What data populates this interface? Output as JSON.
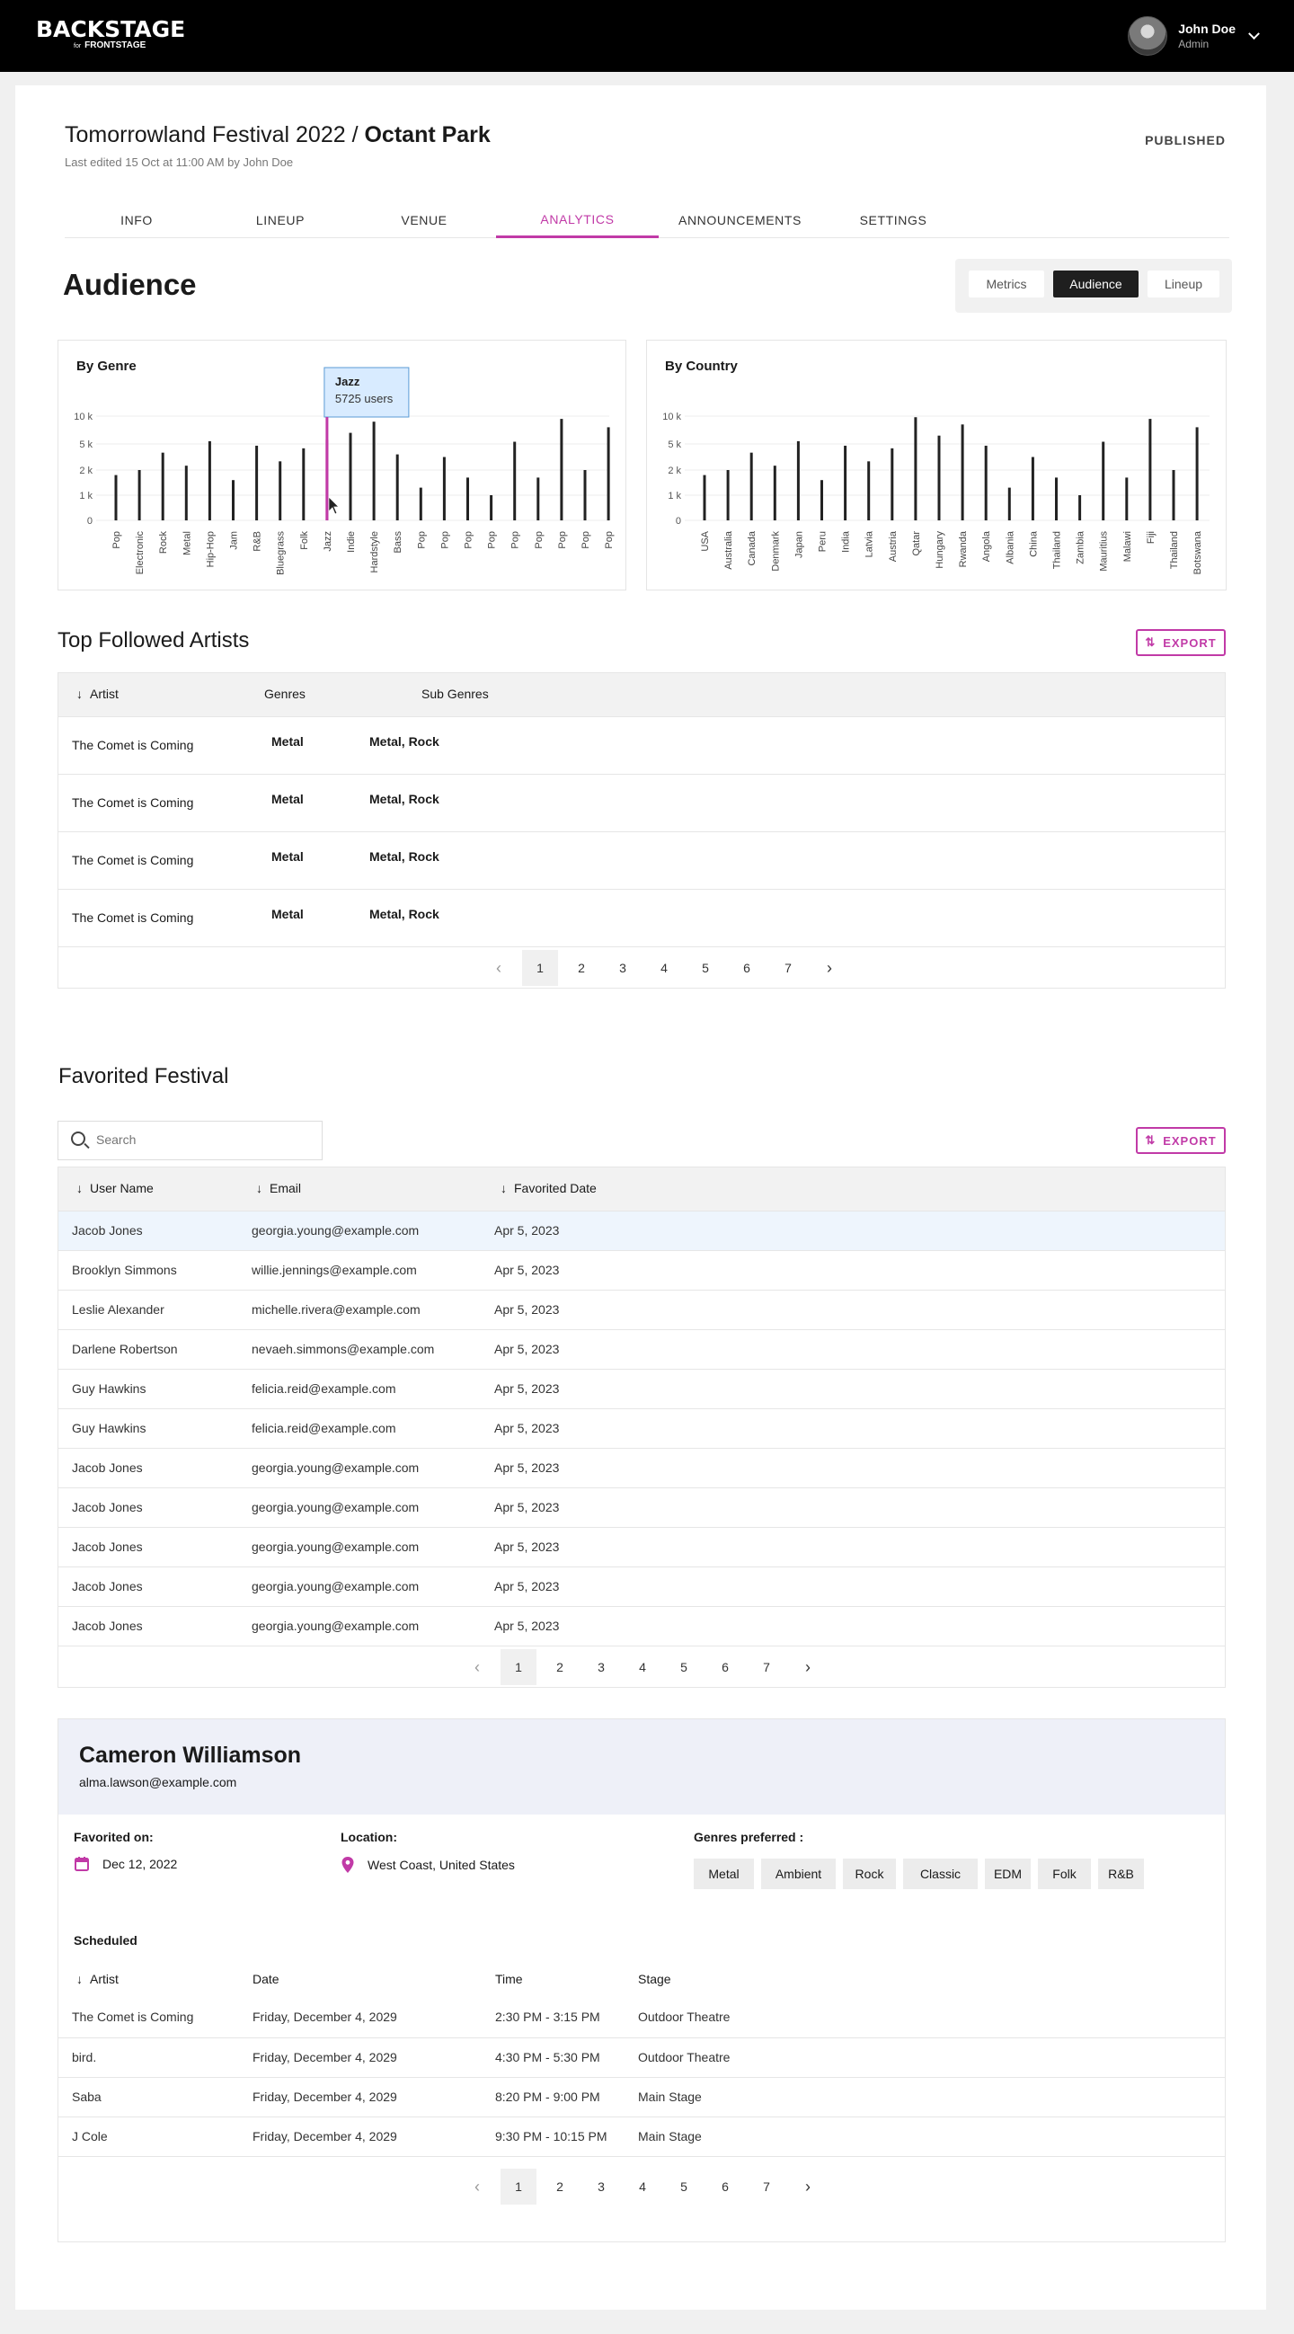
{
  "header": {
    "logo_main": "BACKSTAGE",
    "logo_for": "for",
    "logo_sub": "FRONTSTAGE",
    "user_name": "John Doe",
    "user_role": "Admin"
  },
  "event": {
    "title_part1": "Tomorrowland Festival 2022 / ",
    "title_part2": "Octant Park",
    "subtitle": "Last edited 15 Oct at 11:00 AM by John Doe",
    "status": "PUBLISHED"
  },
  "tabs": [
    "INFO",
    "LINEUP",
    "VENUE",
    "ANALYTICS",
    "ANNOUNCEMENTS",
    "SETTINGS"
  ],
  "active_tab": "ANALYTICS",
  "audience": {
    "heading": "Audience",
    "segments": [
      "Metrics",
      "Audience",
      "Lineup"
    ],
    "active_segment": "Audience"
  },
  "colors": {
    "accent": "#c13aa7",
    "tooltip_bg": "#d8ebff",
    "tooltip_border": "#5b9bd5"
  },
  "chart_data": [
    {
      "type": "bar",
      "title": "By Genre",
      "yticks": [
        "0",
        "1 k",
        "2 k",
        "5 k",
        "10 k"
      ],
      "categories": [
        "Pop",
        "Electronic",
        "Rock",
        "Metal",
        "Hip-Hop",
        "Jam",
        "R&B",
        "Bluegrass",
        "Folk",
        "Jazz",
        "Indie",
        "Hardstyle",
        "Bass",
        "Pop",
        "Pop",
        "Pop",
        "Pop",
        "Pop",
        "Pop",
        "Pop",
        "Pop",
        "Pop"
      ],
      "values": [
        1800,
        2000,
        4000,
        2500,
        5500,
        1600,
        4800,
        3000,
        4500,
        5725,
        7000,
        9000,
        3800,
        1300,
        3500,
        1700,
        1000,
        5400,
        1700,
        9500,
        2000,
        8000
      ],
      "tooltip": {
        "label": "Jazz",
        "value_text": "5725 users"
      },
      "highlight": "Jazz"
    },
    {
      "type": "bar",
      "title": "By Country",
      "yticks": [
        "0",
        "1 k",
        "2 k",
        "5 k",
        "10 k"
      ],
      "categories": [
        "USA",
        "Australia",
        "Canada",
        "Denmark",
        "Japan",
        "Peru",
        "India",
        "Latvia",
        "Austria",
        "Qatar",
        "Hungary",
        "Rwanda",
        "Angola",
        "Albania",
        "China",
        "Thailand",
        "Zambia",
        "Mauritius",
        "Malawi",
        "Fiji",
        "Thailand",
        "Botswana"
      ],
      "values": [
        1800,
        2000,
        4000,
        2500,
        5500,
        1600,
        4800,
        3000,
        4500,
        9800,
        6500,
        8500,
        4800,
        1300,
        3500,
        1700,
        1000,
        5400,
        1700,
        9500,
        2000,
        8000
      ]
    }
  ],
  "top_artists": {
    "heading": "Top Followed Artists",
    "export_label": "EXPORT",
    "columns": [
      "Artist",
      "Genres",
      "Sub Genres"
    ],
    "rows": [
      {
        "artist": "The  Comet is Coming",
        "genre": "Metal",
        "sub": "Metal, Rock"
      },
      {
        "artist": "The  Comet is Coming",
        "genre": "Metal",
        "sub": "Metal, Rock"
      },
      {
        "artist": "The  Comet is Coming",
        "genre": "Metal",
        "sub": "Metal, Rock"
      },
      {
        "artist": "The  Comet is Coming",
        "genre": "Metal",
        "sub": "Metal, Rock"
      }
    ],
    "pages": [
      "1",
      "2",
      "3",
      "4",
      "5",
      "6",
      "7"
    ]
  },
  "favorited": {
    "heading": "Favorited Festival",
    "search_placeholder": "Search",
    "export_label": "EXPORT",
    "columns": [
      "User Name",
      "Email",
      "Favorited Date"
    ],
    "rows": [
      {
        "name": "Jacob Jones",
        "email": "georgia.young@example.com",
        "date": "Apr 5, 2023"
      },
      {
        "name": "Brooklyn Simmons",
        "email": "willie.jennings@example.com",
        "date": "Apr 5, 2023"
      },
      {
        "name": "Leslie Alexander",
        "email": "michelle.rivera@example.com",
        "date": "Apr 5, 2023"
      },
      {
        "name": "Darlene Robertson",
        "email": "nevaeh.simmons@example.com",
        "date": "Apr 5, 2023"
      },
      {
        "name": "Guy Hawkins",
        "email": "felicia.reid@example.com",
        "date": "Apr 5, 2023"
      },
      {
        "name": "Guy Hawkins",
        "email": "felicia.reid@example.com",
        "date": "Apr 5, 2023"
      },
      {
        "name": "Jacob Jones",
        "email": "georgia.young@example.com",
        "date": "Apr 5, 2023"
      },
      {
        "name": "Jacob Jones",
        "email": "georgia.young@example.com",
        "date": "Apr 5, 2023"
      },
      {
        "name": "Jacob Jones",
        "email": "georgia.young@example.com",
        "date": "Apr 5, 2023"
      },
      {
        "name": "Jacob Jones",
        "email": "georgia.young@example.com",
        "date": "Apr 5, 2023"
      },
      {
        "name": "Jacob Jones",
        "email": "georgia.young@example.com",
        "date": "Apr 5, 2023"
      }
    ],
    "pages": [
      "1",
      "2",
      "3",
      "4",
      "5",
      "6",
      "7"
    ]
  },
  "detail": {
    "name": "Cameron Williamson",
    "email": "alma.lawson@example.com",
    "favorited_label": "Favorited on:",
    "favorited_value": "Dec 12, 2022",
    "location_label": "Location:",
    "location_value": "West Coast, United States",
    "genres_label": "Genres preferred :",
    "genres": [
      "Metal",
      "Ambient",
      "Rock",
      "Classic",
      "EDM",
      "Folk",
      "R&B"
    ],
    "scheduled_label": "Scheduled",
    "columns": [
      "Artist",
      "Date",
      "Time",
      "Stage"
    ],
    "rows": [
      {
        "artist": "The  Comet is Coming",
        "date": "Friday, December 4, 2029",
        "time": "2:30 PM - 3:15 PM",
        "stage": "Outdoor Theatre"
      },
      {
        "artist": "bird.",
        "date": "Friday, December 4, 2029",
        "time": "4:30 PM - 5:30 PM",
        "stage": "Outdoor Theatre"
      },
      {
        "artist": "Saba",
        "date": "Friday, December 4, 2029",
        "time": "8:20 PM - 9:00 PM",
        "stage": "Main Stage"
      },
      {
        "artist": "J Cole",
        "date": "Friday, December 4, 2029",
        "time": "9:30 PM - 10:15 PM",
        "stage": "Main Stage"
      }
    ],
    "pages": [
      "1",
      "2",
      "3",
      "4",
      "5",
      "6",
      "7"
    ]
  }
}
